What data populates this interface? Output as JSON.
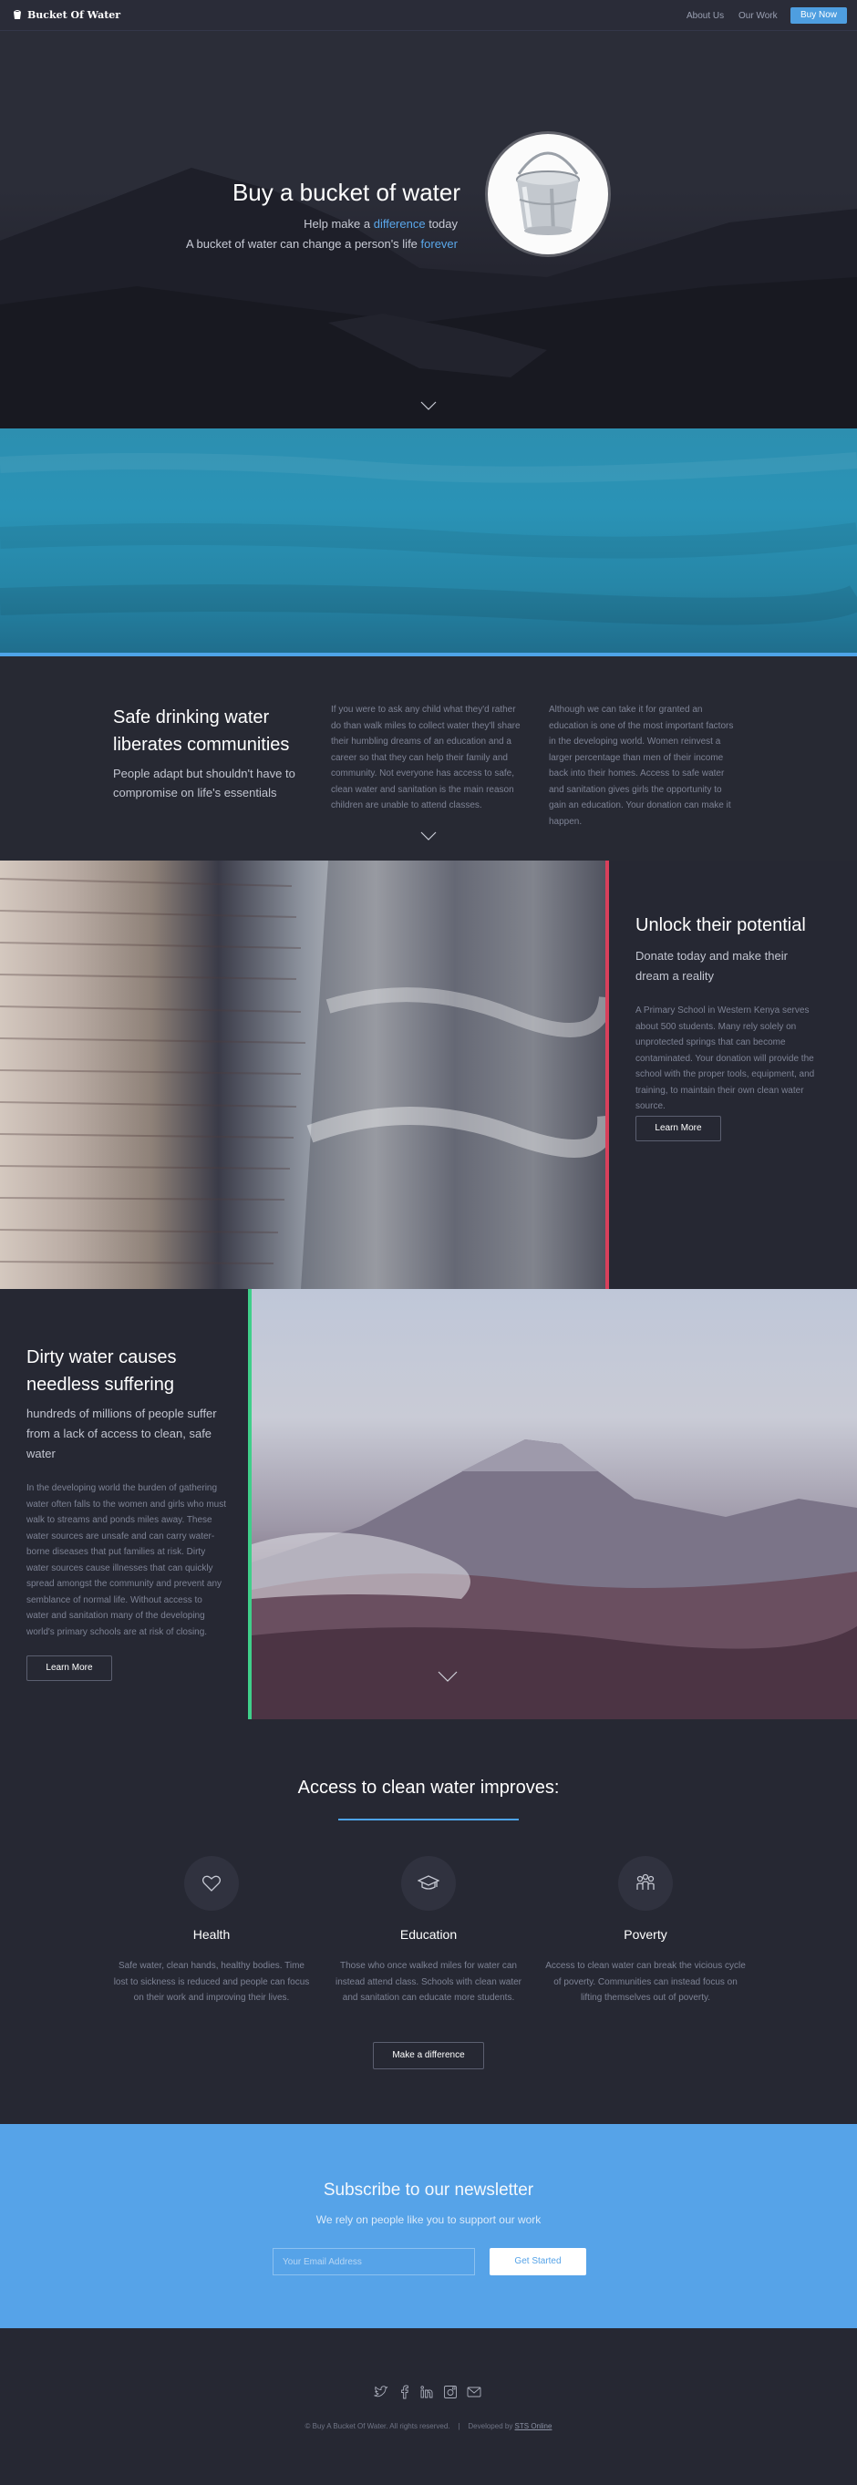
{
  "nav": {
    "brand": "Bucket Of Water",
    "links": [
      "About Us",
      "Our Work"
    ],
    "cta": "Buy Now"
  },
  "hero": {
    "title": "Buy a bucket of water",
    "line1_pre": "Help make a ",
    "line1_accent": "difference",
    "line1_post": " today",
    "line2_pre": "A bucket of water can change a person's life ",
    "line2_accent": "forever"
  },
  "safe": {
    "title": "Safe drinking water liberates communities",
    "subtitle": "People adapt but shouldn't have to compromise on life's essentials",
    "col1": "If you were to ask any child what they'd rather do than walk miles to collect water they'll share their humbling dreams of an education and a career so that they can help their family and community. Not everyone has access to safe, clean water and sanitation is the main reason children are unable to attend classes.",
    "col2": "Although we can take it for granted an education is one of the most important factors in the developing world. Women reinvest a larger percentage than men of their income back into their homes. Access to safe water and sanitation gives girls the opportunity to gain an education. Your donation can make it happen."
  },
  "unlock": {
    "title": "Unlock their potential",
    "subtitle": "Donate today and make their dream a reality",
    "body": "A Primary School in Western Kenya serves about 500 students. Many rely solely on unprotected springs that can become contaminated. Your donation will provide the school with the proper tools, equipment, and training, to maintain their own clean water source.",
    "button": "Learn More"
  },
  "dirty": {
    "title": "Dirty water causes needless suffering",
    "subtitle": "hundreds of millions of people suffer from a lack of access to clean, safe water",
    "body": "In the developing world the burden of gathering water often falls to the women and girls who must walk to streams and ponds miles away. These water sources are unsafe and can carry water-borne diseases that put families at risk. Dirty water sources cause illnesses that can quickly spread amongst the community and prevent any semblance of normal life. Without access to water and sanitation many of the developing world's primary schools are at risk of closing.",
    "button": "Learn More"
  },
  "access": {
    "title": "Access to clean water improves:",
    "features": [
      {
        "icon": "heart-icon",
        "title": "Health",
        "body": "Safe water, clean hands, healthy bodies. Time lost to sickness is reduced and people can focus on their work and improving their lives."
      },
      {
        "icon": "graduation-cap-icon",
        "title": "Education",
        "body": "Those who once walked miles for water can instead attend class. Schools with clean water and sanitation can educate more students."
      },
      {
        "icon": "people-icon",
        "title": "Poverty",
        "body": "Access to clean water can break the vicious cycle of poverty. Communities can instead focus on lifting themselves out of poverty."
      }
    ],
    "button": "Make a difference"
  },
  "subscribe": {
    "title": "Subscribe to our newsletter",
    "subtitle": "We rely on people like you to support our work",
    "placeholder": "Your Email Address",
    "button": "Get Started"
  },
  "footer": {
    "social": [
      "twitter-icon",
      "facebook-icon",
      "linkedin-icon",
      "instagram-icon",
      "mail-icon"
    ],
    "copyright": "© Buy A Bucket Of Water. All rights reserved.",
    "separator": "|",
    "developed": "Developed by ",
    "developer": "STS Online"
  },
  "colors": {
    "accent": "#4ea4e8",
    "unlock_rule": "#d8405b",
    "dirty_rule": "#3fcf8a",
    "background": "#262833"
  }
}
